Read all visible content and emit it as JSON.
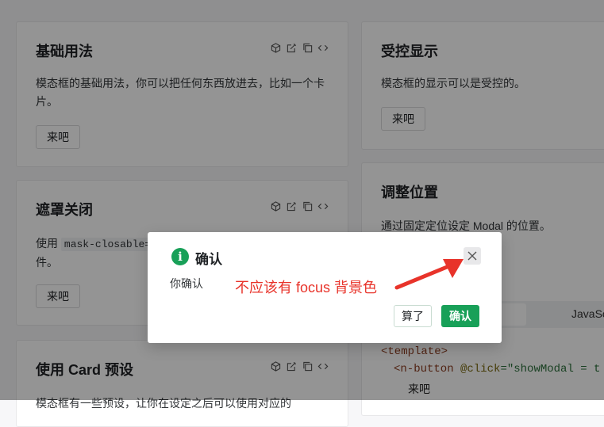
{
  "cards": {
    "basic": {
      "title": "基础用法",
      "desc": "模态框的基础用法，你可以把任何东西放进去，比如一个卡片。",
      "button": "来吧"
    },
    "controlled": {
      "title": "受控显示",
      "desc": "模态框的显示可以是受控的。",
      "button": "来吧"
    },
    "mask": {
      "title": "遮罩关闭",
      "desc_prefix": "使用",
      "code": "mask-closable=",
      "desc_suffix": "件。",
      "button": "来吧"
    },
    "position": {
      "title": "调整位置",
      "desc": "通过固定定位设定 Modal 的位置。"
    },
    "preset": {
      "title": "使用 Card 预设",
      "desc": "模态框有一些预设，让你在设定之后可以使用对应的 "
    }
  },
  "code_tabs": {
    "js": "JavaSc"
  },
  "code": {
    "line1": "<template>",
    "line2_tag": "<n-button",
    "line2_attr": " @click",
    "line2_rest": "=\"showModal = t",
    "line3": "来吧"
  },
  "modal": {
    "title": "确认",
    "info_icon": "i",
    "content": "你确认",
    "cancel_label": "算了",
    "confirm_label": "确认"
  },
  "annotation": {
    "text": "不应该有 focus 背景色",
    "color": "#e8332a"
  },
  "colors": {
    "primary": "#18a058",
    "annotation": "#e8332a"
  }
}
